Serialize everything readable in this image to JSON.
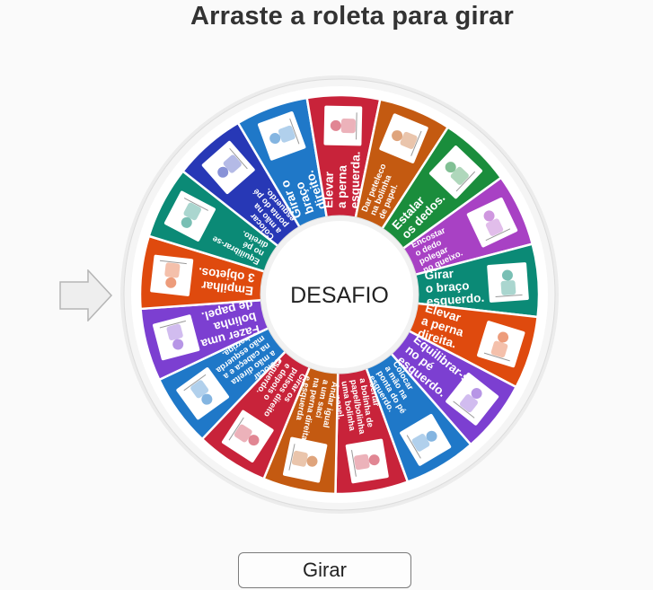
{
  "title": "Arraste a roleta para girar",
  "center_label": "DESAFIO",
  "spin_button_label": "Girar",
  "pointer_icon": "arrow-right-icon",
  "segments": [
    {
      "lines": [
        "Acertar",
        "a bolinha de",
        "papel/bolinha",
        "uma bolinha",
        "de papel."
      ],
      "color": "#c8233a",
      "icon": "paper-ball-throw-icon",
      "small": true
    },
    {
      "lines": [
        "Andar igual",
        "a um saci",
        "na perna direita",
        "e esquerda"
      ],
      "color": "#c45a11",
      "icon": "hopping-icon",
      "small": true
    },
    {
      "lines": [
        "Girar os",
        "pulsos direito",
        "e depois o",
        "esquerdo."
      ],
      "color": "#c8233a",
      "icon": "wrist-icon",
      "small": true
    },
    {
      "lines": [
        "Colocar",
        "a mão direita",
        "na cabeça e a",
        "mão esquerda",
        "na barriga."
      ],
      "color": "#1f78c8",
      "icon": "hands-icon",
      "small": true
    },
    {
      "lines": [
        "Fazer uma",
        "bolinha",
        "de papel."
      ],
      "color": "#7c3fd1",
      "icon": "crumpled-paper-icon",
      "small": false
    },
    {
      "lines": [
        "Empilhar",
        "3 objetos."
      ],
      "color": "#df4a0e",
      "icon": "stack-icon",
      "small": false
    },
    {
      "lines": [
        "Equilibrar-se",
        "no pé",
        "direito."
      ],
      "color": "#0b8a76",
      "icon": "balance-icon",
      "small": true
    },
    {
      "lines": [
        "Colocar",
        "a mão na",
        "ponta do pé",
        "esquerdo."
      ],
      "color": "#2738b6",
      "icon": "toe-touch-icon",
      "small": true
    },
    {
      "lines": [
        "Girar o",
        "braço",
        "direito."
      ],
      "color": "#1f78c8",
      "icon": "arm-circle-icon",
      "small": false
    },
    {
      "lines": [
        "Elevar",
        "a perna",
        "esquerda."
      ],
      "color": "#c8233a",
      "icon": "leg-raise-icon",
      "small": false
    },
    {
      "lines": [
        "Dar peteleco",
        "na bolinha",
        "de papel."
      ],
      "color": "#c45a11",
      "icon": "flick-icon",
      "small": true
    },
    {
      "lines": [
        "Estalar",
        "os dedos."
      ],
      "color": "#1a8d3c",
      "icon": "finger-snap-icon",
      "small": false
    },
    {
      "lines": [
        "Encostar",
        "o dedo",
        "polegar",
        "no queixo."
      ],
      "color": "#a841c4",
      "icon": "thinking-emoji-icon",
      "small": true
    },
    {
      "lines": [
        "Girar",
        "o braço",
        "esquerdo."
      ],
      "color": "#0b8a76",
      "icon": "arm-swing-icon",
      "small": false
    },
    {
      "lines": [
        "Elevar",
        "a perna",
        "direita."
      ],
      "color": "#df4a0e",
      "icon": "leg-raise-right-icon",
      "small": false
    },
    {
      "lines": [
        "Equilibrar-se",
        "no pé",
        "esquerdo."
      ],
      "color": "#7c3fd1",
      "icon": "stand-one-foot-icon",
      "small": false
    },
    {
      "lines": [
        "Colocar",
        "a mão na",
        "ponta do pé",
        "esquerdo."
      ],
      "color": "#1f78c8",
      "icon": "stretch-icon",
      "small": true
    }
  ]
}
